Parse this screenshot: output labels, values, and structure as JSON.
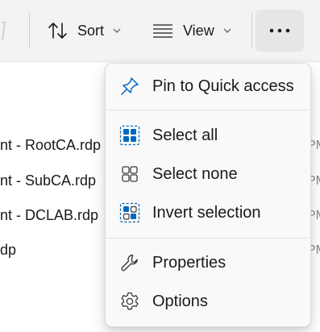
{
  "toolbar": {
    "sort_label": "Sort",
    "view_label": "View",
    "more_icon": "ellipsis-icon",
    "accent": "#0067c0"
  },
  "files": [
    {
      "name": "nt - RootCA.rdp",
      "time": "PM"
    },
    {
      "name": "nt - SubCA.rdp",
      "time": "PM"
    },
    {
      "name": "nt - DCLAB.rdp",
      "time": "PM"
    },
    {
      "name": "dp",
      "time": "PM"
    }
  ],
  "menu": {
    "items": [
      {
        "label": "Pin to Quick access",
        "icon": "pin-icon"
      },
      {
        "label": "Select all",
        "icon": "select-all-icon"
      },
      {
        "label": "Select none",
        "icon": "select-none-icon"
      },
      {
        "label": "Invert selection",
        "icon": "invert-selection-icon"
      },
      {
        "label": "Properties",
        "icon": "wrench-icon"
      },
      {
        "label": "Options",
        "icon": "gear-icon"
      }
    ]
  }
}
